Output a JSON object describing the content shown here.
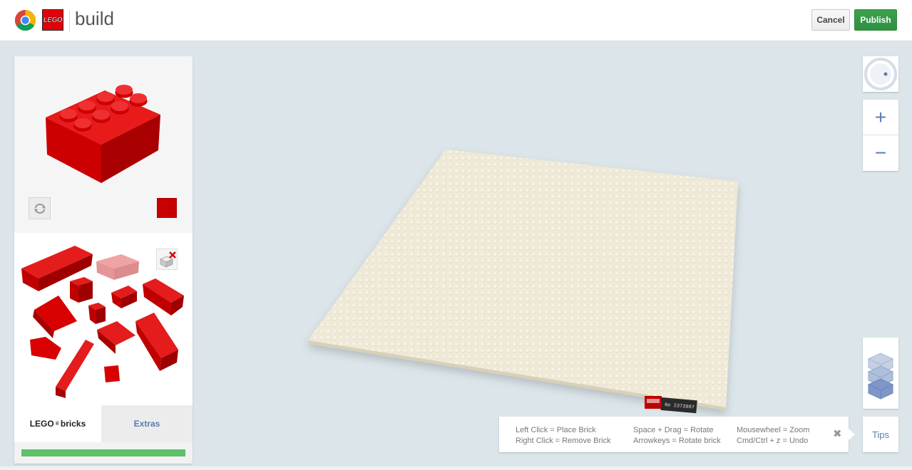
{
  "header": {
    "app_title": "build",
    "logo_text": "LEGO",
    "cancel_label": "Cancel",
    "publish_label": "Publish"
  },
  "brick_panel": {
    "selected_color": "#c70000",
    "tabs": [
      {
        "label": "LEGO",
        "suffix": "bricks",
        "mark": "®",
        "active": true
      },
      {
        "label": "Extras",
        "active": false
      }
    ],
    "progress_percent": 100
  },
  "baseplate": {
    "stamp_text": "No 2373987",
    "color": "#f1ecdc"
  },
  "tips": {
    "lines": [
      [
        "Left Click = Place Brick",
        "Right Click = Remove Brick"
      ],
      [
        "Space + Drag = Rotate",
        "Arrowkeys = Rotate brick"
      ],
      [
        "Mousewheel = Zoom",
        "Cmd/Ctrl + z = Undo"
      ]
    ],
    "button_label": "Tips",
    "close_glyph": "✖"
  },
  "zoom": {
    "in_glyph": "+",
    "out_glyph": "−"
  },
  "colors": {
    "brand_red": "#e3000b",
    "brick_red": "#c70000",
    "publish_green": "#3ca04e",
    "accent_blue": "#5b7bb0"
  }
}
